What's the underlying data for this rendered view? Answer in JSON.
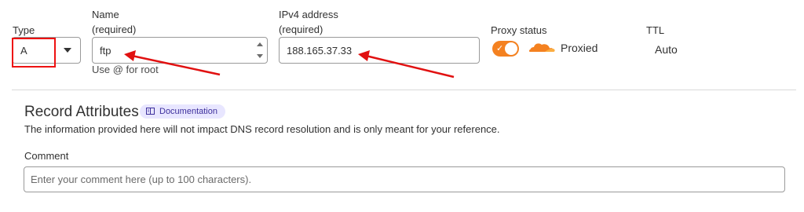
{
  "fields": {
    "type": {
      "label": "Type",
      "value": "A"
    },
    "name": {
      "label": "Name",
      "sublabel": "(required)",
      "value": "ftp",
      "help": "Use @ for root"
    },
    "ipv4": {
      "label": "IPv4 address",
      "sublabel": "(required)",
      "value": "188.165.37.33"
    },
    "proxy": {
      "label": "Proxy status",
      "state": "Proxied",
      "enabled": true,
      "accent": "#f48120"
    },
    "ttl": {
      "label": "TTL",
      "value": "Auto"
    }
  },
  "record_attributes": {
    "title": "Record Attributes",
    "doc_badge": "Documentation",
    "info": "The information provided here will not impact DNS record resolution and is only meant for your reference.",
    "comment_label": "Comment",
    "comment_placeholder": "Enter your comment here (up to 100 characters)."
  },
  "icons": {
    "type_dropdown": "chevron-down-icon",
    "name_spinner": "spinner-icon",
    "proxy_cloud": "cloud-icon",
    "toggle_check": "checkmark-icon",
    "doc_badge": "book-icon"
  },
  "annotations": {
    "color": "#e11111"
  }
}
